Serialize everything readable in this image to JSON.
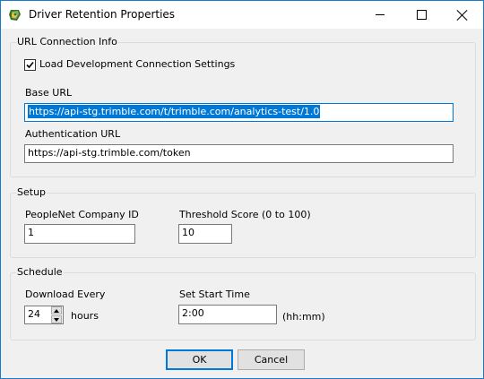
{
  "window": {
    "title": "Driver Retention Properties"
  },
  "url_group": {
    "title": "URL Connection Info",
    "load_dev_label": "Load Development Connection Settings",
    "load_dev_checked": true,
    "base_url_label": "Base URL",
    "base_url_value": "https://api-stg.trimble.com/t/trimble.com/analytics-test/1.0",
    "auth_url_label": "Authentication URL",
    "auth_url_value": "https://api-stg.trimble.com/token"
  },
  "setup_group": {
    "title": "Setup",
    "company_id_label": "PeopleNet Company ID",
    "company_id_value": "1",
    "threshold_label": "Threshold Score (0 to 100)",
    "threshold_value": "10"
  },
  "schedule_group": {
    "title": "Schedule",
    "download_label": "Download Every",
    "download_value": "24",
    "hours_label": "hours",
    "start_time_label": "Set Start Time",
    "start_time_value": "2:00",
    "time_format_label": "(hh:mm)"
  },
  "buttons": {
    "ok": "OK",
    "cancel": "Cancel"
  },
  "icons": {
    "app": "app-icon",
    "minimize": "minimize-icon",
    "maximize": "maximize-icon",
    "close": "close-icon",
    "check": "checkmark-icon",
    "spin_up": "arrow-up-icon",
    "spin_down": "arrow-down-icon"
  }
}
